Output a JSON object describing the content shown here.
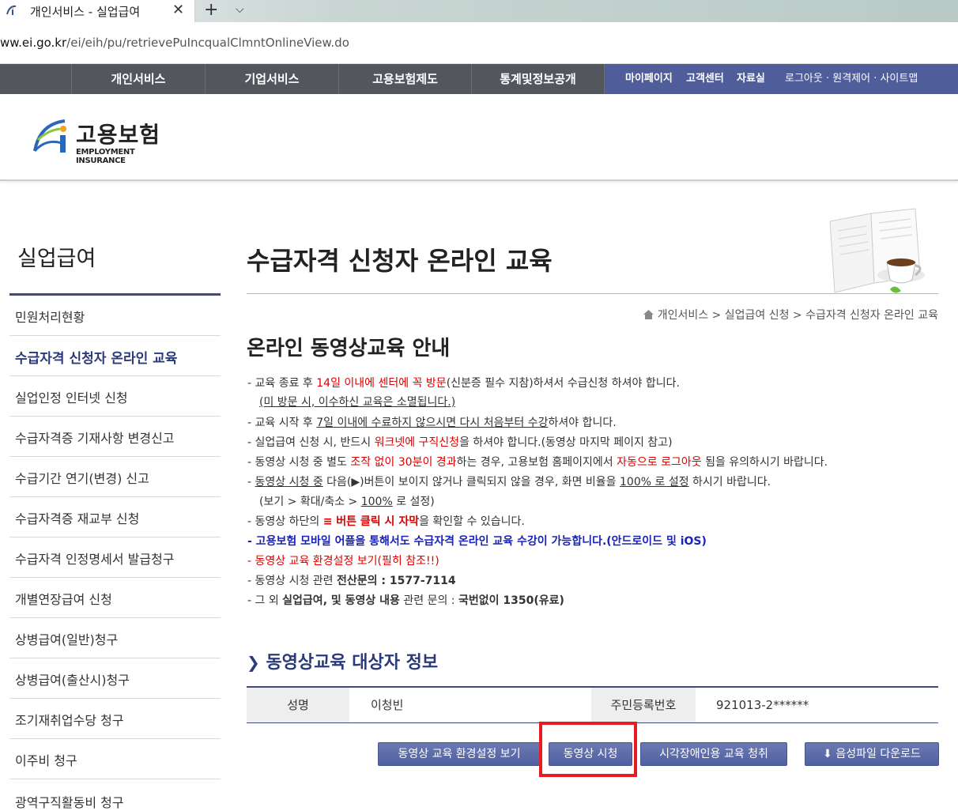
{
  "browser": {
    "tab_title": "개인서비스 - 실업급여",
    "close_glyph": "✕",
    "newtab_glyph": "+",
    "menu_glyph": "⌵",
    "url_prefix": "ww.ei.go.kr",
    "url_path": "/ei/eih/pu/retrievePuIncqualClmntOnlineView.do"
  },
  "topnav": {
    "items": [
      "개인서비스",
      "기업서비스",
      "고용보험제도",
      "통계및정보공개"
    ],
    "right_items": [
      "마이페이지",
      "고객센터",
      "자료실"
    ],
    "util_links": "로그아웃 · 원격제어 · 사이트맵"
  },
  "logo": {
    "korean": "고용보험",
    "english": "EMPLOYMENT INSURANCE"
  },
  "sidebar": {
    "title": "실업급여",
    "items": [
      "민원처리현황",
      "수급자격 신청자 온라인 교육",
      "실업인정 인터넷 신청",
      "수급자격증 기재사항 변경신고",
      "수급기간 연기(변경) 신고",
      "수급자격증 재교부 신청",
      "수급자격 인정명세서 발급청구",
      "개별연장급여 신청",
      "상병급여(일반)청구",
      "상병급여(출산시)청구",
      "조기재취업수당 청구",
      "이주비 청구",
      "광역구직활동비 청구"
    ],
    "active_index": 1
  },
  "main": {
    "page_title": "수급자격 신청자 온라인 교육",
    "breadcrumb": "개인서비스 > 실업급여 신청 > 수급자격 신청자 온라인 교육",
    "section_title": "온라인 동영상교육 안내",
    "notices": {
      "n1a": "- 교육 종료 후 ",
      "n1b": "14일 이내에 센터에 꼭 방문",
      "n1c": "(신분증 필수 지참)하셔서 수급신청 하셔야 합니다.",
      "n2": "(미 방문 시, 이수하신 교육은 소멸됩니다.)",
      "n3a": "- 교육 시작 후 ",
      "n3b": "7일 이내에 수료하지 않으시면 다시 처음부터 수강",
      "n3c": "하셔야 합니다.",
      "n4a": "- 실업급여 신청 시, 반드시 ",
      "n4b": "워크넷에 구직신청",
      "n4c": "을 하셔야 합니다.(동영상 마지막 페이지 참고)",
      "n5a": "- 동영상 시청 중 별도 ",
      "n5b": "조작 없이 30분이 경과",
      "n5c": "하는 경우, 고용보험 홈페이지에서 ",
      "n5d": "자동으로 로그아웃",
      "n5e": " 됨을 유의하시기 바랍니다.",
      "n6a": "- ",
      "n6b": "동영상 시청 중",
      "n6c": " 다음(▶)버튼이 보이지 않거나 클릭되지 않을 경우, 화면 비율을 ",
      "n6d": "100% 로 설정",
      "n6e": " 하시기 바랍니다.",
      "n7a": "(보기 > 확대/축소 > ",
      "n7b": "100%",
      "n7c": " 로 설정)",
      "n8a": "- 동영상 하단의 ",
      "n8b": "≡ 버튼 클릭 시 자막",
      "n8c": "을 확인할 수 있습니다.",
      "n9": "- 고용보험 모바일 어플을 통해서도 수급자격 온라인 교육 수강이 가능합니다.(안드로이드 및 iOS)",
      "n10": "- 동영상 교육 환경설정 보기(필히 참조!!)",
      "n11a": "- 동영상 시청 관련 ",
      "n11b": "전산문의 : 1577-7114",
      "n12a": "- 그 외 ",
      "n12b": "실업급여, 및 동영상 내용",
      "n12c": " 관련 문의 : ",
      "n12d": "국번없이 1350(유료)"
    },
    "target_title": "동영상교육 대상자 정보",
    "table": {
      "name_label": "성명",
      "name_value": "이청빈",
      "id_label": "주민등록번호",
      "id_value": "921013-2******"
    },
    "buttons": {
      "env": "동영상 교육 환경설정 보기",
      "watch": "동영상 시청",
      "blind": "시각장애인용 교육 청취",
      "audio": "음성파일 다운로드"
    }
  },
  "colors": {
    "nav_bg": "#54565e",
    "nav_right_bg": "#4f5d9a",
    "accent": "#2b3a7a",
    "highlight": "#e81a22"
  }
}
